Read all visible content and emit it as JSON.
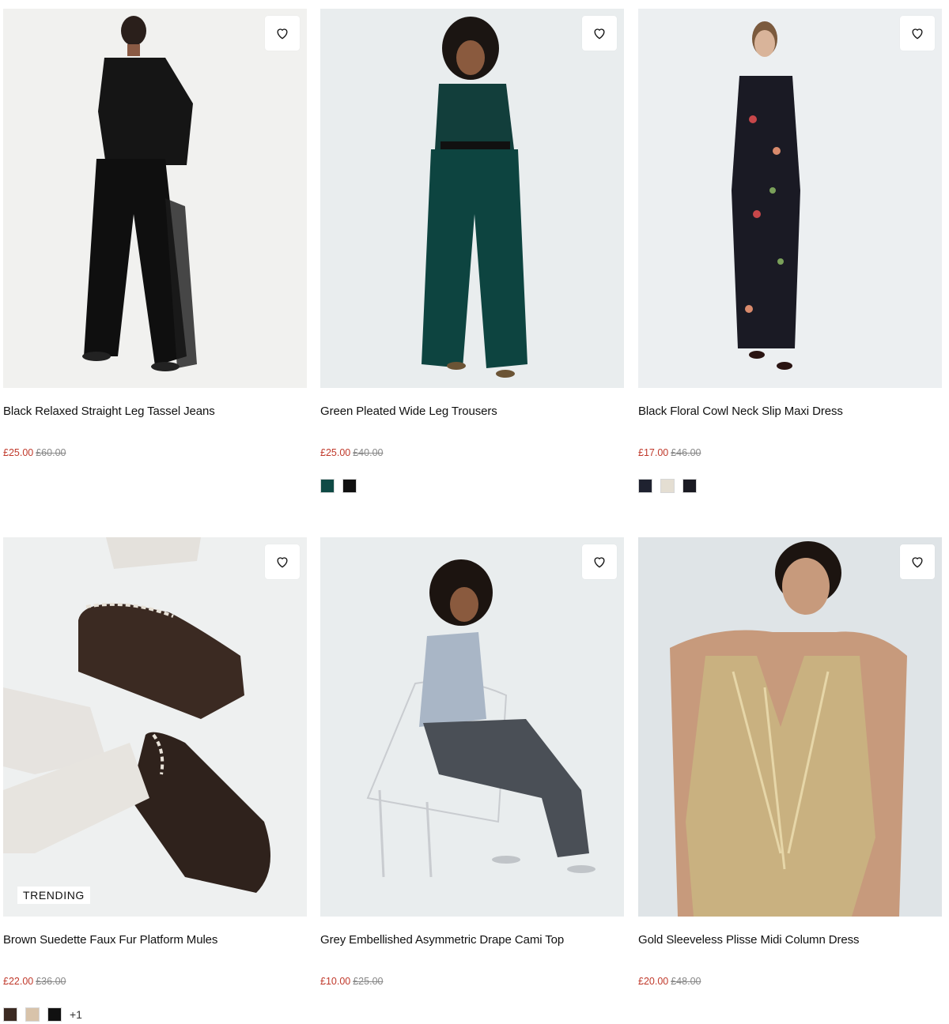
{
  "products": [
    {
      "name": "Black Relaxed Straight Leg Tassel Jeans",
      "price": "£25.00",
      "was_price": "£60.00",
      "swatches": [],
      "badge": ""
    },
    {
      "name": "Green Pleated Wide Leg Trousers",
      "price": "£25.00",
      "was_price": "£40.00",
      "swatches": [
        "#0f4a45",
        "#111111"
      ],
      "badge": ""
    },
    {
      "name": "Black Floral Cowl Neck Slip Maxi Dress",
      "price": "£17.00",
      "was_price": "£46.00",
      "swatches": [
        "#1f2230",
        "#e4ded2",
        "#1a1a22"
      ],
      "badge": ""
    },
    {
      "name": "Brown Suedette Faux Fur Platform Mules",
      "price": "£22.00",
      "was_price": "£36.00",
      "swatches": [
        "#3b2a22",
        "#d8c3aa",
        "#111111"
      ],
      "more": "+1",
      "badge": "TRENDING"
    },
    {
      "name": "Grey Embellished Asymmetric Drape Cami Top",
      "price": "£10.00",
      "was_price": "£25.00",
      "swatches": [],
      "badge": ""
    },
    {
      "name": "Gold Sleeveless Plisse Midi Column Dress",
      "price": "£20.00",
      "was_price": "£48.00",
      "swatches": [],
      "badge": ""
    }
  ],
  "icons": {
    "wishlist": "heart-outline-icon"
  },
  "colors": {
    "sale_price": "#c0392b",
    "was_price": "#888888",
    "image_bg": "#edeff0"
  }
}
